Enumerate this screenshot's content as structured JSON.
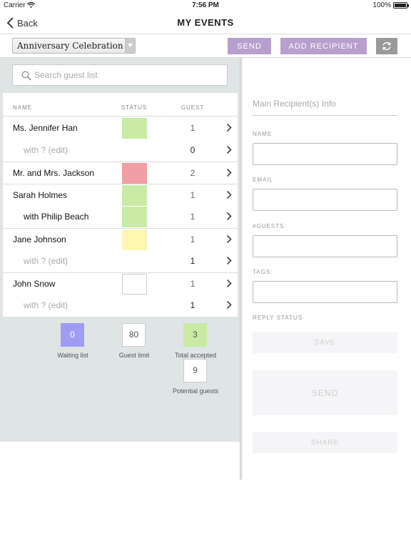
{
  "status_bar": {
    "carrier": "Carrier",
    "time": "7:56 PM",
    "battery": "100%"
  },
  "nav": {
    "back_label": "Back",
    "title": "MY EVENTS"
  },
  "toolbar": {
    "event_select": "Anniversary Celebration",
    "send_label": "SEND",
    "add_recipient_label": "ADD RECIPIENT",
    "refresh_icon": "refresh-icon"
  },
  "search": {
    "placeholder": "Search guest list",
    "value": ""
  },
  "guest_list": {
    "headers": {
      "name": "NAME",
      "status": "STATUS",
      "guest": "GUEST"
    },
    "rows": [
      {
        "name": "Ms. Jennifer Han",
        "status_color": "#c9eba6",
        "guests": "1",
        "sub": false,
        "muted": false
      },
      {
        "name": "with ? (edit)",
        "status_color": "",
        "guests": "0",
        "sub": true,
        "muted": true
      },
      {
        "name": "Mr. and Mrs. Jackson",
        "status_color": "#f19ea4",
        "guests": "2",
        "sub": false,
        "muted": false
      },
      {
        "name": "Sarah Holmes",
        "status_color": "#c9eba6",
        "guests": "1",
        "sub": false,
        "muted": false
      },
      {
        "name": "with Philip Beach",
        "status_color": "#c9eba6",
        "guests": "1",
        "sub": true,
        "muted": false
      },
      {
        "name": "Jane Johnson",
        "status_color": "#fbf7b3",
        "guests": "1",
        "sub": false,
        "muted": false
      },
      {
        "name": "with ? (edit)",
        "status_color": "",
        "guests": "1",
        "sub": true,
        "muted": true
      },
      {
        "name": "John Snow",
        "status_color": "outline",
        "guests": "1",
        "sub": false,
        "muted": false
      },
      {
        "name": "with ? (edit)",
        "status_color": "",
        "guests": "1",
        "sub": true,
        "muted": true
      }
    ]
  },
  "summary": {
    "waiting_list": {
      "value": "0",
      "label": "Waiting list",
      "color": "#9e9cf3"
    },
    "guest_limit": {
      "value": "80",
      "label": "Guest limit"
    },
    "total_accepted": {
      "value": "3",
      "label": "Total accepted",
      "color": "#c9eba6"
    },
    "potential_guests": {
      "value": "9",
      "label": "Potential guests"
    }
  },
  "recipient_panel": {
    "title": "Main Recipient(s) Info",
    "name_label": "NAME",
    "email_label": "EMAIL",
    "guests_label": "#GUESTS:",
    "tags_label": "TAGS:",
    "reply_status_label": "REPLY STATUS",
    "save_label": "SAVE",
    "send_label": "SEND",
    "share_label": "SHARE"
  }
}
